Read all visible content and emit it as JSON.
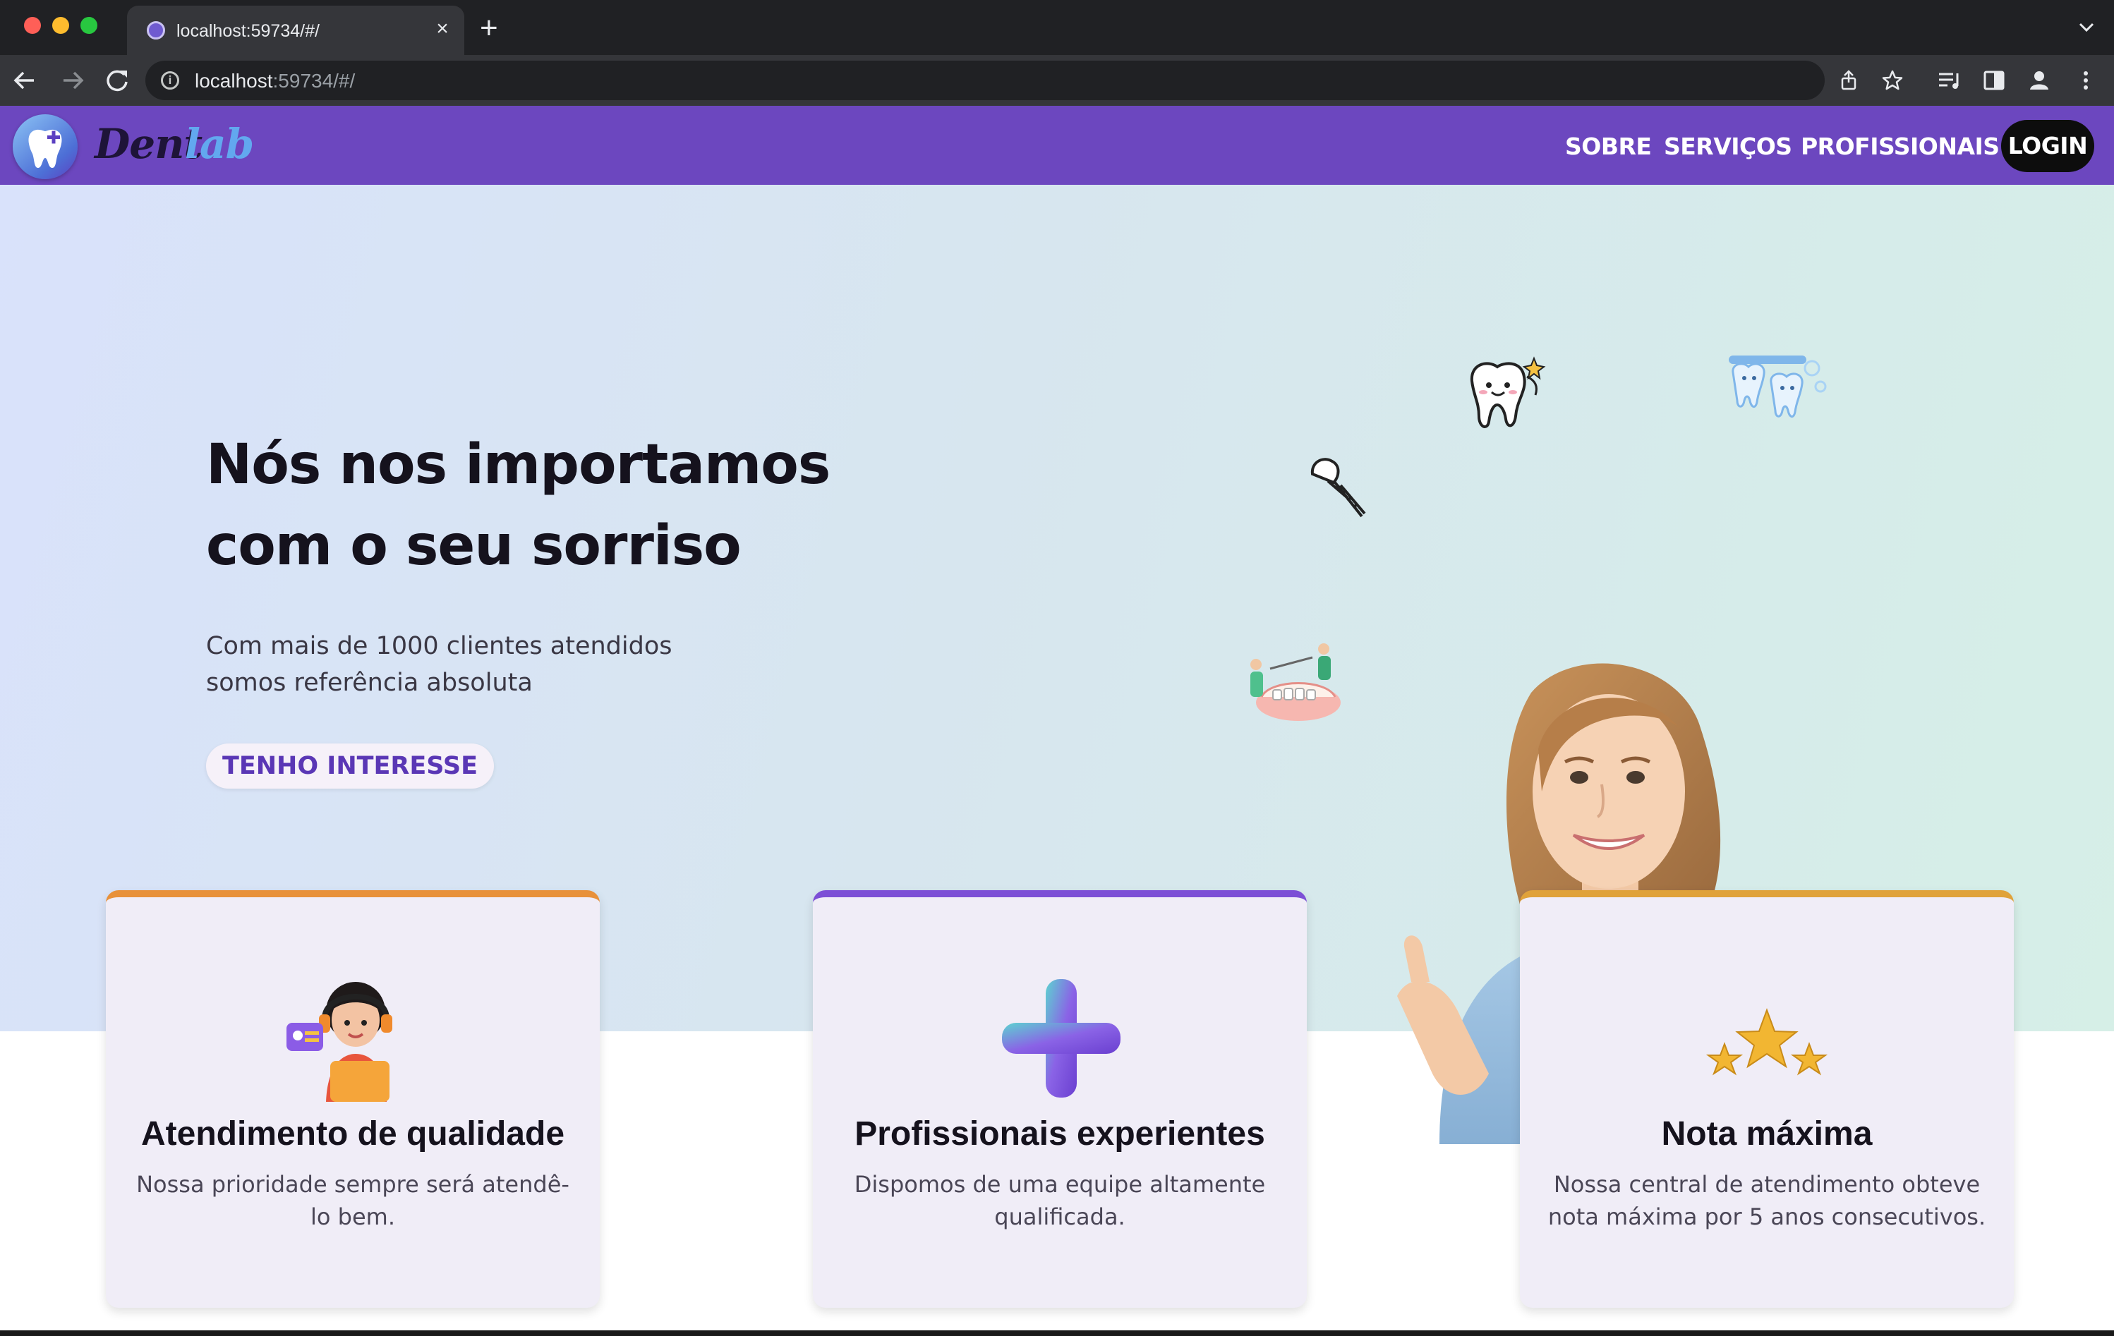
{
  "browser": {
    "tab_title": "localhost:59734/#/",
    "tab_close": "×",
    "new_tab": "+",
    "url_host": "localhost",
    "url_rest": ":59734/#/"
  },
  "header": {
    "logo_dent": "Dent",
    "logo_lab": "lab",
    "nav": [
      "SOBRE",
      "SERVIÇOS",
      "PROFISSIONAIS"
    ],
    "login_label": "LOGIN",
    "brand_color": "#6c47bf"
  },
  "hero": {
    "title_line1": "Nós nos importamos",
    "title_line2": "com o seu sorriso",
    "subtitle_line1": "Com mais de 1000 clientes atendidos",
    "subtitle_line2": "somos referência absoluta",
    "cta_label": "TENHO INTERESSE"
  },
  "cards": [
    {
      "title": "Atendimento de qualidade",
      "text": "Nossa prioridade sempre será atendê-lo bem.",
      "icon": "support-agent-icon",
      "accent": "#e8913a"
    },
    {
      "title": "Profissionais experientes",
      "text": "Dispomos de uma equipe altamente qualificada.",
      "icon": "plus-cross-icon",
      "accent": "#7c4fd6"
    },
    {
      "title": "Nota máxima",
      "text": "Nossa central de atendimento obteve nota máxima por 5 anos consecutivos.",
      "icon": "stars-icon",
      "accent": "#e0a23a"
    }
  ]
}
